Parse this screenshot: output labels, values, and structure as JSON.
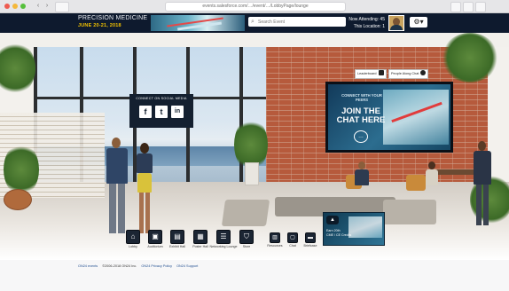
{
  "browser": {
    "url": "events.salesforce.com/…/event/…/LobbyPage/lounge",
    "nav_back": "‹",
    "nav_forward": "›"
  },
  "header": {
    "brand_title": "PRECISION MEDICINE",
    "brand_date": "JUNE 20-21, 2018",
    "search_placeholder": "Search Event",
    "attending_label": "Now Attending: 45",
    "location_label": "This Location: 1",
    "settings_icon": "gear-icon",
    "settings_caret": "▾"
  },
  "scene": {
    "social_title": "CONNECT ON SOCIAL MEDIA",
    "social_icons": [
      "f",
      "t",
      "in"
    ],
    "tv_line1": "CONNECT WITH YOUR PEERS",
    "tv_line2": "JOIN THE CHAT HERE",
    "tag_leaderboard": "Leaderboard",
    "tag_people": "People Along Chat"
  },
  "toolbar": {
    "main": [
      {
        "label": "Lobby",
        "icon": "home-icon",
        "glyph": "⌂"
      },
      {
        "label": "Auditorium",
        "icon": "auditorium-icon",
        "glyph": "▣"
      },
      {
        "label": "Exhibit Hall",
        "icon": "exhibit-hall-icon",
        "glyph": "▤"
      },
      {
        "label": "Poster Hall",
        "icon": "poster-hall-icon",
        "glyph": "▦"
      },
      {
        "label": "Networking Lounge",
        "icon": "networking-lounge-icon",
        "glyph": "☰"
      },
      {
        "label": "Store",
        "icon": "store-icon",
        "glyph": "⛉"
      }
    ],
    "secondary": [
      {
        "label": "Resources",
        "icon": "resources-icon",
        "glyph": "▥"
      },
      {
        "label": "Chat",
        "icon": "chat-icon",
        "glyph": "▢"
      },
      {
        "label": "Briefcase",
        "icon": "briefcase-icon",
        "glyph": "▬"
      }
    ]
  },
  "promo": {
    "line1": "Earn 20th",
    "line2": "CME / CE Credits"
  },
  "footer": {
    "brand": "ON24 events",
    "copyright": "©2006-2018 ON24 Inc.",
    "privacy": "ON24 Privacy Policy",
    "support": "ON24 Support"
  },
  "colors": {
    "topbar": "#0e1a2e",
    "accent_date": "#f0c000",
    "brick": "#b65a3c"
  }
}
